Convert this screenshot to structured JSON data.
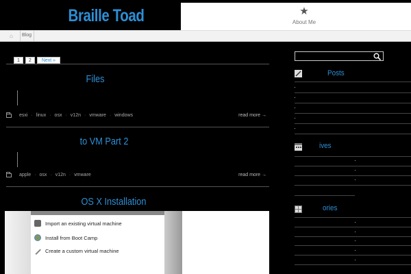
{
  "site": {
    "title": "Braille Toad"
  },
  "nav": {
    "about_label": "About Me",
    "about_icon": "star-icon"
  },
  "breadcrumb": {
    "home_icon": "home-icon",
    "item": "Blog"
  },
  "pager": {
    "pages": [
      "1",
      "2"
    ],
    "next": "Next »"
  },
  "posts": [
    {
      "title": "Files",
      "tags": [
        "esxi",
        "linux",
        "osx",
        "v12n",
        "vmware",
        "windows"
      ],
      "more": "read more →"
    },
    {
      "title": "to VM Part 2",
      "tags": [
        "apple",
        "osx",
        "v12n",
        "vmware"
      ],
      "more": "read more →"
    },
    {
      "title": "OS X Installation",
      "screenshot": {
        "options": [
          "Import an existing virtual machine",
          "Install from Boot Camp",
          "Create a custom virtual machine"
        ]
      }
    }
  ],
  "sidebar": {
    "search": {
      "placeholder": ""
    },
    "widgets": [
      {
        "title": "Posts",
        "icon": "pencil-icon"
      },
      {
        "title": "ives",
        "icon": "calendar-icon"
      },
      {
        "title": "ories",
        "icon": "grid-icon"
      }
    ]
  },
  "colors": {
    "accent": "#2d8fd5",
    "background": "#000000"
  }
}
